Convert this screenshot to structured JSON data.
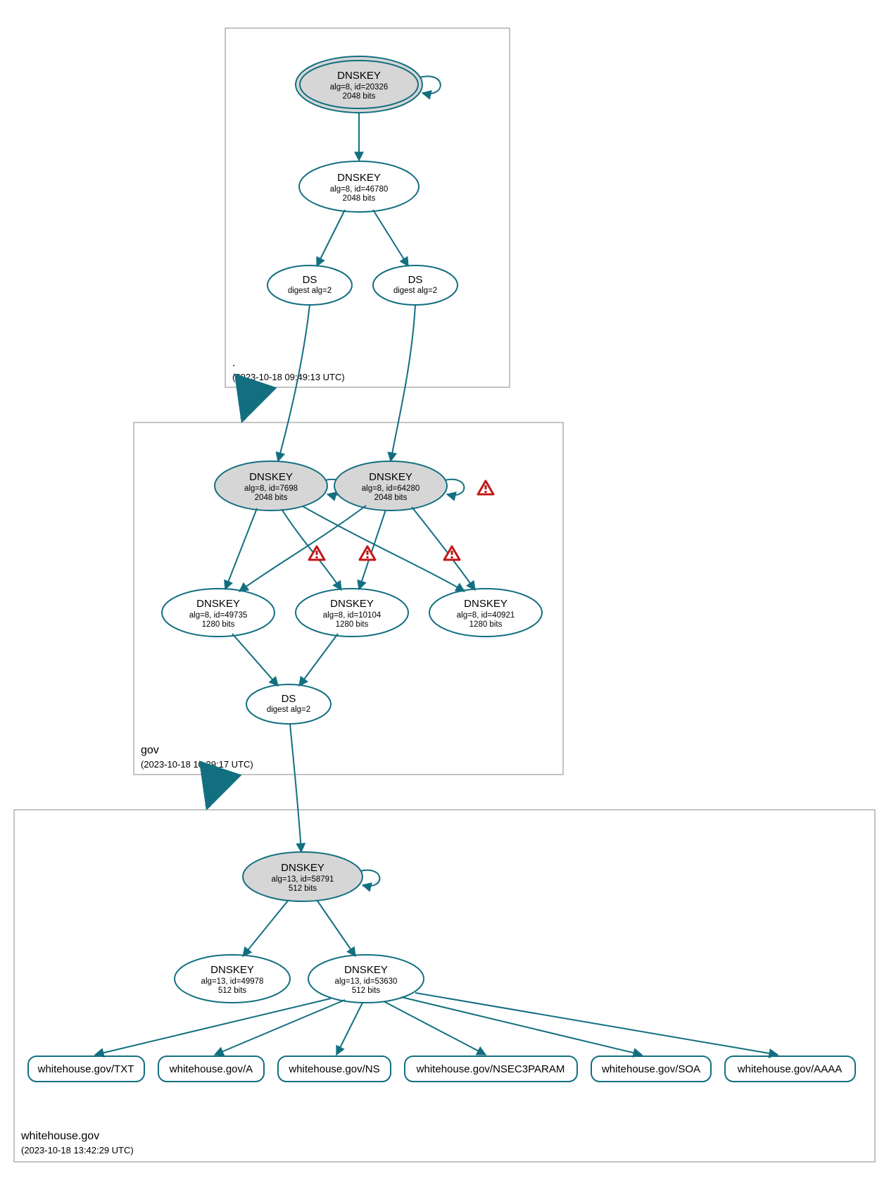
{
  "colors": {
    "teal": "#126f80",
    "gray": "#d6d6d6",
    "warning": "#c21818"
  },
  "zones": [
    {
      "id": "root",
      "label": ".",
      "timestamp": "(2023-10-18 09:49:13 UTC)"
    },
    {
      "id": "gov",
      "label": "gov",
      "timestamp": "(2023-10-18 10:39:17 UTC)"
    },
    {
      "id": "wh",
      "label": "whitehouse.gov",
      "timestamp": "(2023-10-18 13:42:29 UTC)"
    }
  ],
  "nodes": {
    "root_ksk": {
      "title": "DNSKEY",
      "line1": "alg=8, id=20326",
      "line2": "2048 bits"
    },
    "root_zsk": {
      "title": "DNSKEY",
      "line1": "alg=8, id=46780",
      "line2": "2048 bits"
    },
    "root_ds1": {
      "title": "DS",
      "line1": "digest alg=2",
      "line2": ""
    },
    "root_ds2": {
      "title": "DS",
      "line1": "digest alg=2",
      "line2": ""
    },
    "gov_ksk1": {
      "title": "DNSKEY",
      "line1": "alg=8, id=7698",
      "line2": "2048 bits"
    },
    "gov_ksk2": {
      "title": "DNSKEY",
      "line1": "alg=8, id=64280",
      "line2": "2048 bits"
    },
    "gov_zsk1": {
      "title": "DNSKEY",
      "line1": "alg=8, id=49735",
      "line2": "1280 bits"
    },
    "gov_zsk2": {
      "title": "DNSKEY",
      "line1": "alg=8, id=10104",
      "line2": "1280 bits"
    },
    "gov_zsk3": {
      "title": "DNSKEY",
      "line1": "alg=8, id=40921",
      "line2": "1280 bits"
    },
    "gov_ds": {
      "title": "DS",
      "line1": "digest alg=2",
      "line2": ""
    },
    "wh_ksk": {
      "title": "DNSKEY",
      "line1": "alg=13, id=58791",
      "line2": "512 bits"
    },
    "wh_zsk1": {
      "title": "DNSKEY",
      "line1": "alg=13, id=49978",
      "line2": "512 bits"
    },
    "wh_zsk2": {
      "title": "DNSKEY",
      "line1": "alg=13, id=53630",
      "line2": "512 bits"
    }
  },
  "records": [
    {
      "id": "rec_txt",
      "label": "whitehouse.gov/TXT"
    },
    {
      "id": "rec_a",
      "label": "whitehouse.gov/A"
    },
    {
      "id": "rec_ns",
      "label": "whitehouse.gov/NS"
    },
    {
      "id": "rec_nsec3",
      "label": "whitehouse.gov/NSEC3PARAM"
    },
    {
      "id": "rec_soa",
      "label": "whitehouse.gov/SOA"
    },
    {
      "id": "rec_aaaa",
      "label": "whitehouse.gov/AAAA"
    }
  ],
  "warnings": [
    {
      "attached_to": "gov_ksk2"
    },
    {
      "attached_to": "edge_gov_ksk2_to_zsk1"
    },
    {
      "attached_to": "edge_gov_ksk2_to_zsk2"
    },
    {
      "attached_to": "edge_gov_ksk2_to_zsk3"
    }
  ]
}
